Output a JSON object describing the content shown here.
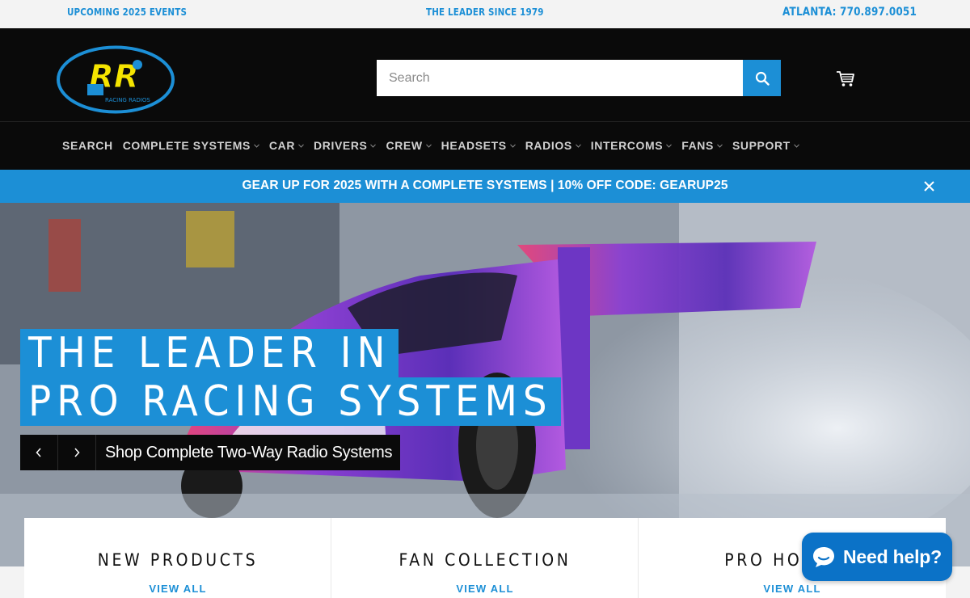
{
  "topbar": {
    "events": "UPCOMING 2025 EVENTS",
    "tagline": "THE LEADER SINCE 1979",
    "phone": "ATLANTA: 770.897.0051"
  },
  "header": {
    "logo_text": "RR",
    "logo_sub": "RACING RADIOS",
    "search_placeholder": "Search",
    "icons": {
      "search": "search-icon",
      "cart": "cart-icon"
    }
  },
  "nav": {
    "items": [
      {
        "label": "SEARCH",
        "dropdown": false
      },
      {
        "label": "COMPLETE SYSTEMS",
        "dropdown": true
      },
      {
        "label": "CAR",
        "dropdown": true
      },
      {
        "label": "DRIVERS",
        "dropdown": true
      },
      {
        "label": "CREW",
        "dropdown": true
      },
      {
        "label": "HEADSETS",
        "dropdown": true
      },
      {
        "label": "RADIOS",
        "dropdown": true
      },
      {
        "label": "INTERCOMS",
        "dropdown": true
      },
      {
        "label": "FANS",
        "dropdown": true
      },
      {
        "label": "SUPPORT",
        "dropdown": true
      }
    ]
  },
  "announcement": {
    "text": "GEAR UP FOR 2025 WITH A COMPLETE SYSTEMS | 10% OFF CODE: GEARUP25",
    "close_icon": "close-icon"
  },
  "hero": {
    "title_line1": "THE LEADER IN",
    "title_line2": "PRO RACING SYSTEMS",
    "cta": "Shop Complete Two-Way Radio Systems",
    "icons": {
      "prev": "chevron-left-icon",
      "next": "chevron-right-icon"
    }
  },
  "collections": [
    {
      "title": "NEW PRODUCTS",
      "link": "VIEW ALL"
    },
    {
      "title": "FAN COLLECTION",
      "link": "VIEW ALL"
    },
    {
      "title": "PRO HOLIDAY",
      "link": "VIEW ALL"
    }
  ],
  "chat": {
    "label": "Need help?",
    "icon": "chat-bubble-icon"
  },
  "colors": {
    "accent": "#1c8fd6",
    "header_bg": "#0a0a0a",
    "chat_bg": "#0b72c7",
    "logo_yellow": "#f5e400"
  }
}
